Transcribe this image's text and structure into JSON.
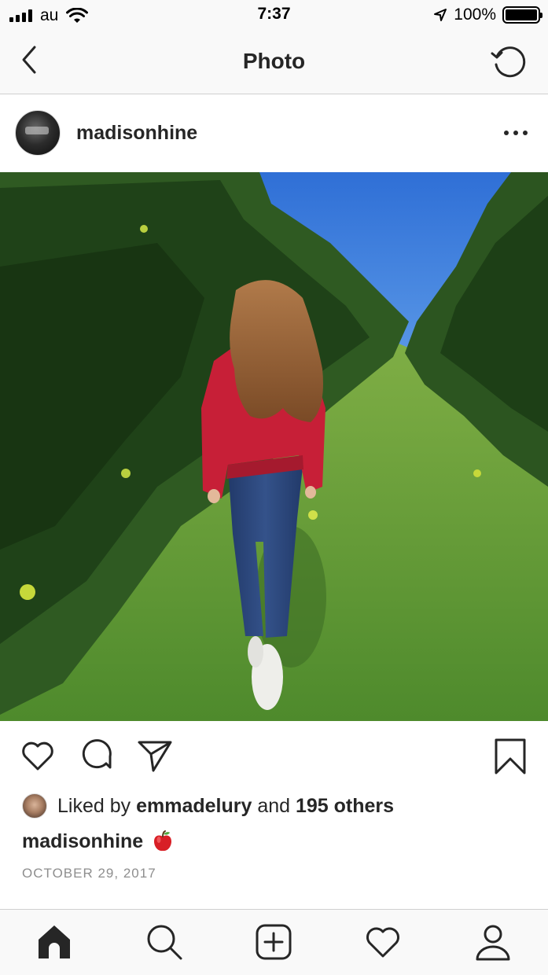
{
  "status_bar": {
    "carrier": "au",
    "time": "7:37",
    "battery": "100%"
  },
  "header": {
    "title": "Photo"
  },
  "post": {
    "username": "madisonhine",
    "likes": {
      "prefix": "Liked by",
      "liker": "emmadelury",
      "connector": "and",
      "others": "195 others"
    },
    "caption": {
      "username": "madisonhine",
      "emoji_icon": "red-apple-emoji"
    },
    "date": "OCTOBER 29, 2017"
  },
  "icons": {
    "back": "chevron-left-icon",
    "refresh": "refresh-icon",
    "more": "more-dots-icon",
    "like": "heart-icon",
    "comment": "comment-icon",
    "share": "send-icon",
    "save": "bookmark-icon",
    "tabs": [
      "home-icon",
      "search-icon",
      "add-post-icon",
      "activity-heart-icon",
      "profile-icon"
    ]
  },
  "colors": {
    "text": "#262626",
    "muted": "#8e8e8e",
    "bar_background": "#f9f9f9"
  }
}
